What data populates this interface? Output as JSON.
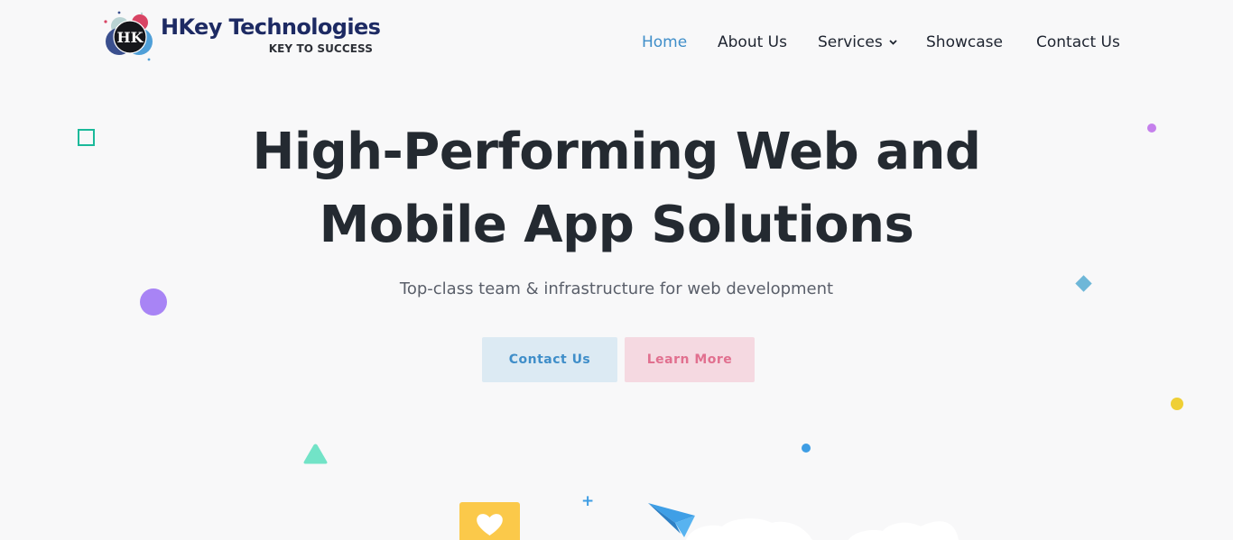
{
  "brand": {
    "name": "HKey Technologies",
    "tagline": "KEY TO SUCCESS",
    "monogram": "HK",
    "colors": {
      "primary": "#1d2a63",
      "accent_blue": "#3f8ec9",
      "accent_pink": "#e1708f"
    }
  },
  "nav": {
    "items": [
      {
        "label": "Home",
        "active": true
      },
      {
        "label": "About Us",
        "active": false
      },
      {
        "label": "Services",
        "active": false,
        "has_dropdown": true,
        "icon": "chevron-down-icon"
      },
      {
        "label": "Showcase",
        "active": false
      },
      {
        "label": "Contact Us",
        "active": false
      }
    ]
  },
  "hero": {
    "title_line1": "High-Performing Web and",
    "title_line2": "Mobile App Solutions",
    "subtitle": "Top-class team & infrastructure for web development",
    "buttons": {
      "contact": "Contact Us",
      "learn_more": "Learn More"
    }
  },
  "decorations": {
    "icons": [
      "square-outline-icon",
      "circle-icon",
      "diamond-icon",
      "triangle-icon",
      "plus-icon",
      "heart-icon",
      "paper-plane-icon",
      "cloud-icon"
    ]
  }
}
